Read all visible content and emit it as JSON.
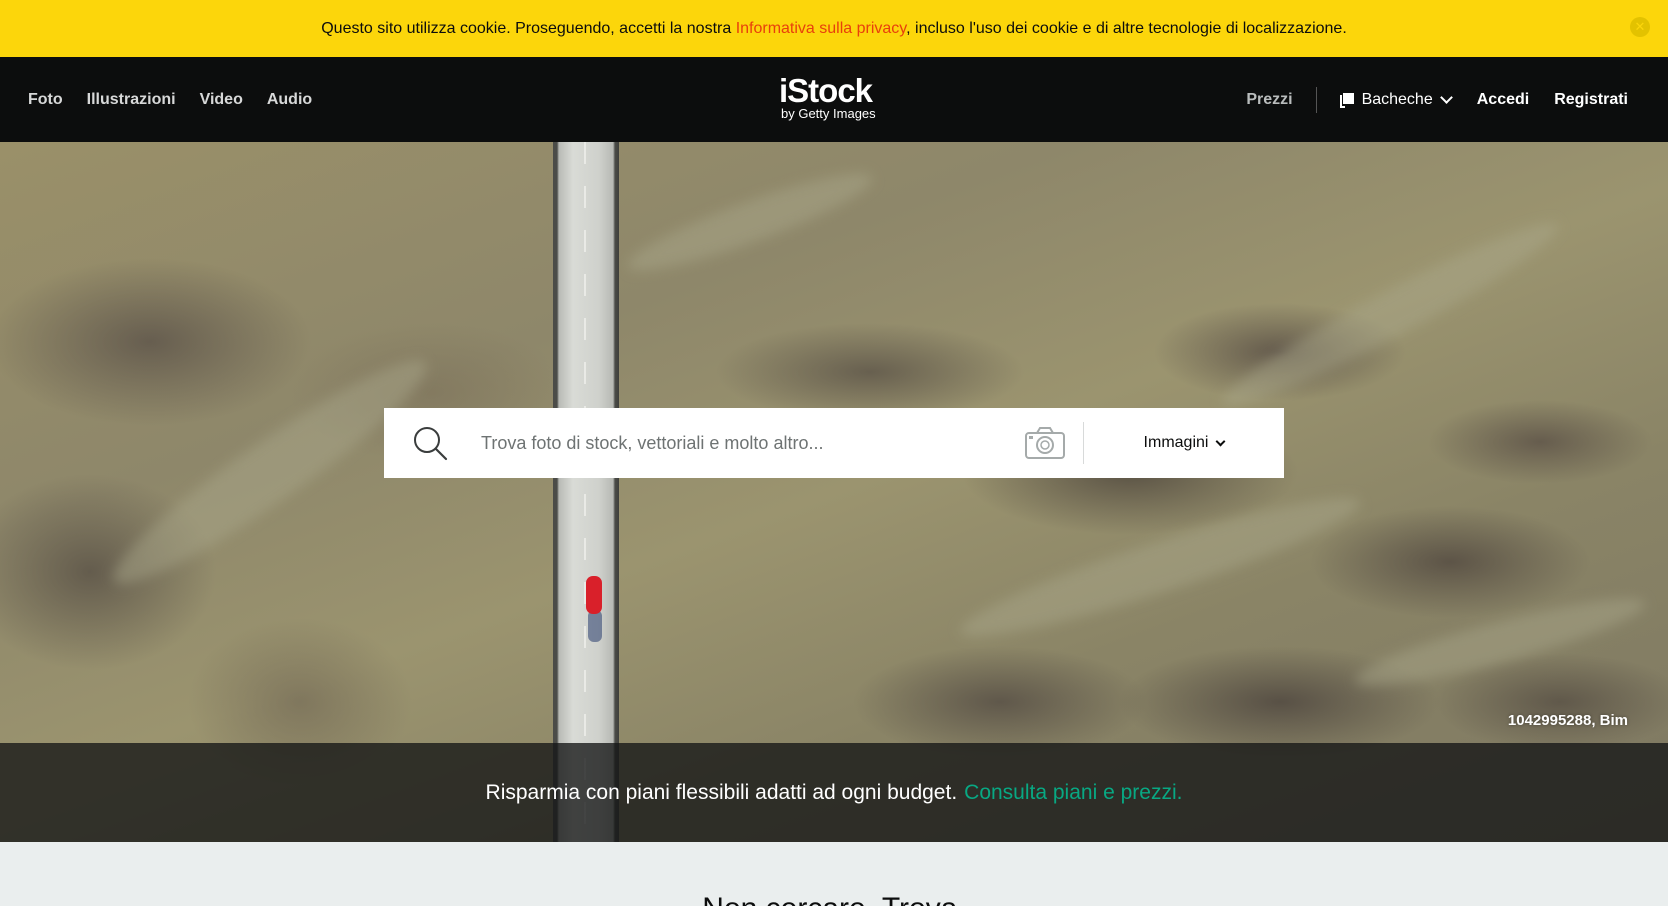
{
  "cookie_banner": {
    "text_before": "Questo sito utilizza cookie. Proseguendo, accetti la nostra ",
    "link": "Informativa sulla privacy",
    "text_after": ", incluso l'uso dei cookie e di altre tecnologie di localizzazione.",
    "close_glyph": "✕"
  },
  "header": {
    "nav": [
      "Foto",
      "Illustrazioni",
      "Video",
      "Audio"
    ],
    "logo_main": "iStock",
    "logo_sub": "by Getty Images",
    "pricing": "Prezzi",
    "boards": "Bacheche",
    "signin": "Accedi",
    "register": "Registrati"
  },
  "search": {
    "placeholder": "Trova foto di stock, vettoriali e molto altro...",
    "value": "",
    "media_type": "Immagini"
  },
  "hero": {
    "credit": "1042995288, Bim"
  },
  "promo": {
    "text": "Risparmia con piani flessibili adatti ad ogni budget.",
    "link": "Consulta piani e prezzi."
  },
  "section": {
    "title": "Non cercare. Trova."
  },
  "colors": {
    "cookie_bg": "#fcd60b",
    "header_bg": "#0c0d0d",
    "link_orange": "#e8400c",
    "accent_green": "#08a883"
  }
}
